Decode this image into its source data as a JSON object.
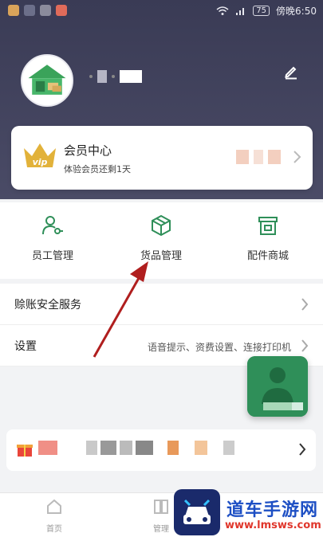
{
  "status_bar": {
    "carrier_time": "傍晚6:50",
    "battery": "75"
  },
  "profile": {
    "edit_icon": "edit-icon"
  },
  "vip": {
    "title": "会员中心",
    "subtitle": "体验会员还剩1天",
    "badge_text": "vip"
  },
  "grid": [
    {
      "label": "员工管理",
      "icon": "staff-key-icon"
    },
    {
      "label": "货品管理",
      "icon": "package-box-icon"
    },
    {
      "label": "配件商城",
      "icon": "store-icon"
    }
  ],
  "menu": [
    {
      "title": "赊账安全服务",
      "hint": ""
    },
    {
      "title": "设置",
      "hint": "语音提示、资费设置、连接打印机"
    }
  ],
  "nav": [
    {
      "label": "首页",
      "icon": "home-icon"
    },
    {
      "label": "管理",
      "icon": "manage-icon"
    }
  ],
  "watermark": {
    "title": "道车手游网",
    "url": "www.lmsws.com"
  },
  "colors": {
    "header": "#3a3b55",
    "accent_green": "#2f8f59",
    "arrow_red": "#b01e1e"
  }
}
